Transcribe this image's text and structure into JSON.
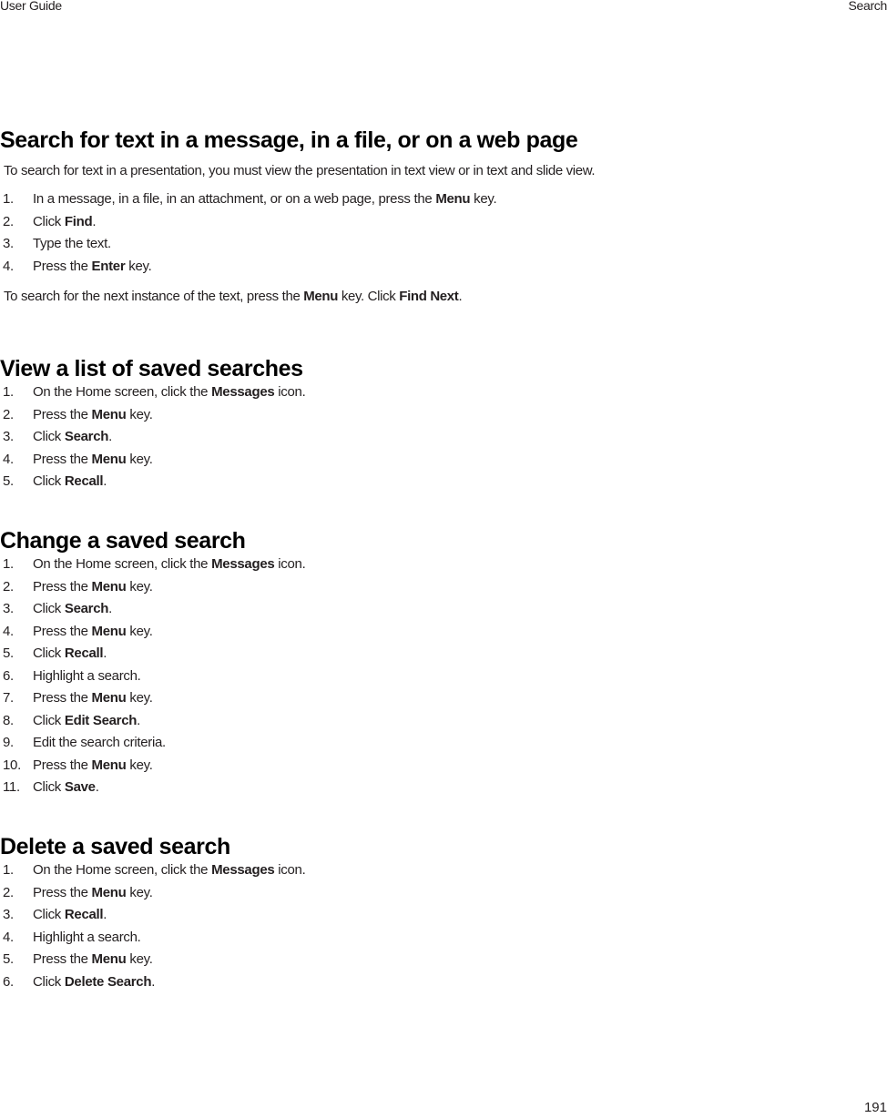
{
  "header": {
    "left": "User Guide",
    "right": "Search"
  },
  "footer": {
    "page_number": "191"
  },
  "sections": [
    {
      "title": "Search for text in a message, in a file, or on a web page",
      "intro": "To search for text in a presentation, you must view the presentation in text view or in text and slide view.",
      "steps": [
        [
          [
            "In a message, in a file, in an attachment, or on a web page, press the ",
            false
          ],
          [
            "Menu",
            true
          ],
          [
            " key.",
            false
          ]
        ],
        [
          [
            "Click ",
            false
          ],
          [
            "Find",
            true
          ],
          [
            ".",
            false
          ]
        ],
        [
          [
            "Type the text.",
            false
          ]
        ],
        [
          [
            "Press the ",
            false
          ],
          [
            "Enter",
            true
          ],
          [
            " key.",
            false
          ]
        ]
      ],
      "note": [
        [
          "To search for the next instance of the text, press the ",
          false
        ],
        [
          "Menu",
          true
        ],
        [
          " key. Click ",
          false
        ],
        [
          "Find Next",
          true
        ],
        [
          ".",
          false
        ]
      ]
    },
    {
      "title": "View a list of saved searches",
      "steps": [
        [
          [
            "On the Home screen, click the ",
            false
          ],
          [
            "Messages",
            true
          ],
          [
            " icon.",
            false
          ]
        ],
        [
          [
            "Press the ",
            false
          ],
          [
            "Menu",
            true
          ],
          [
            " key.",
            false
          ]
        ],
        [
          [
            "Click ",
            false
          ],
          [
            "Search",
            true
          ],
          [
            ".",
            false
          ]
        ],
        [
          [
            "Press the ",
            false
          ],
          [
            "Menu",
            true
          ],
          [
            " key.",
            false
          ]
        ],
        [
          [
            "Click ",
            false
          ],
          [
            "Recall",
            true
          ],
          [
            ".",
            false
          ]
        ]
      ]
    },
    {
      "title": "Change a saved search",
      "steps": [
        [
          [
            "On the Home screen, click the ",
            false
          ],
          [
            "Messages",
            true
          ],
          [
            " icon.",
            false
          ]
        ],
        [
          [
            "Press the ",
            false
          ],
          [
            "Menu",
            true
          ],
          [
            " key.",
            false
          ]
        ],
        [
          [
            "Click ",
            false
          ],
          [
            "Search",
            true
          ],
          [
            ".",
            false
          ]
        ],
        [
          [
            "Press the ",
            false
          ],
          [
            "Menu",
            true
          ],
          [
            " key.",
            false
          ]
        ],
        [
          [
            "Click ",
            false
          ],
          [
            "Recall",
            true
          ],
          [
            ".",
            false
          ]
        ],
        [
          [
            "Highlight a search.",
            false
          ]
        ],
        [
          [
            "Press the ",
            false
          ],
          [
            "Menu",
            true
          ],
          [
            " key.",
            false
          ]
        ],
        [
          [
            "Click ",
            false
          ],
          [
            "Edit Search",
            true
          ],
          [
            ".",
            false
          ]
        ],
        [
          [
            "Edit the search criteria.",
            false
          ]
        ],
        [
          [
            "Press the ",
            false
          ],
          [
            "Menu",
            true
          ],
          [
            " key.",
            false
          ]
        ],
        [
          [
            "Click ",
            false
          ],
          [
            "Save",
            true
          ],
          [
            ".",
            false
          ]
        ]
      ]
    },
    {
      "title": "Delete a saved search",
      "steps": [
        [
          [
            "On the Home screen, click the ",
            false
          ],
          [
            "Messages",
            true
          ],
          [
            " icon.",
            false
          ]
        ],
        [
          [
            "Press the ",
            false
          ],
          [
            "Menu",
            true
          ],
          [
            " key.",
            false
          ]
        ],
        [
          [
            "Click ",
            false
          ],
          [
            "Recall",
            true
          ],
          [
            ".",
            false
          ]
        ],
        [
          [
            "Highlight a search.",
            false
          ]
        ],
        [
          [
            "Press the ",
            false
          ],
          [
            "Menu",
            true
          ],
          [
            " key.",
            false
          ]
        ],
        [
          [
            "Click ",
            false
          ],
          [
            "Delete Search",
            true
          ],
          [
            ".",
            false
          ]
        ]
      ]
    }
  ]
}
